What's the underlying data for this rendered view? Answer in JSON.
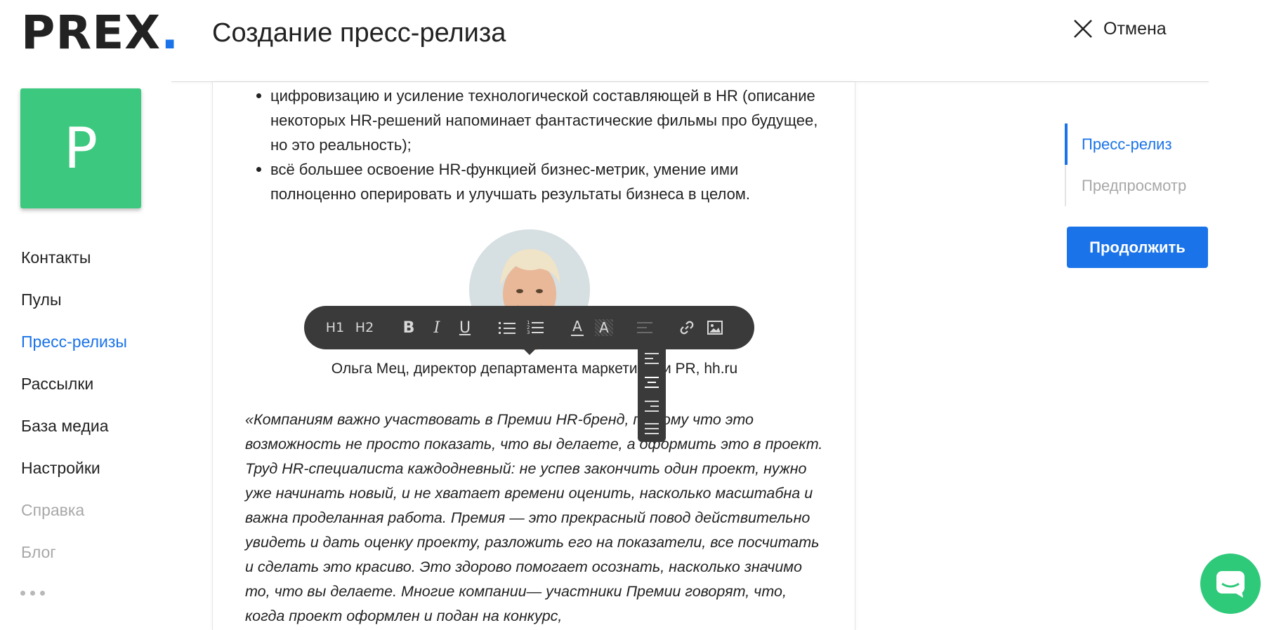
{
  "brand": {
    "name": "PREX",
    "dot": ".",
    "accent": "#1a73e8"
  },
  "avatar": {
    "letter": "P",
    "color": "#3cc97f"
  },
  "sidebar": {
    "items": [
      {
        "label": "Контакты"
      },
      {
        "label": "Пулы"
      },
      {
        "label": "Пресс-релизы"
      },
      {
        "label": "Рассылки"
      },
      {
        "label": "База медиа"
      },
      {
        "label": "Настройки"
      },
      {
        "label": "Справка"
      },
      {
        "label": "Блог"
      }
    ]
  },
  "header": {
    "title": "Создание пресс-релиза",
    "cancel_label": "Отмена"
  },
  "editor": {
    "bullets": [
      "цифровизацию и усиление технологической составляющей в HR (описание некоторых HR-решений напоминает фантастические фильмы про будущее, но это реальность);",
      "всё большее освоение HR-функцией бизнес-метрик, умение ими полноценно оперировать и улучшать результаты бизнеса в целом."
    ],
    "caption": "Ольга Мец, директор департамента маркетинга и PR, hh.ru",
    "quote": "«Компаниям важно участвовать в Премии HR-бренд, потому что это возможность не просто показать, что вы делаете, а оформить это в проект. Труд HR-специалиста каждодневный: не успев закончить один проект, нужно уже начинать новый, и не хватает времени оценить, насколько масштабна и важна проделанная работа. Премия — это прекрасный повод действительно увидеть и дать оценку проекту, разложить его на показатели, все посчитать и сделать это красиво. Это здорово помогает осознать, насколько значимо то, что вы делаете. Многие компании— участники Премии говорят, что, когда проект оформлен и подан на конкурс,"
  },
  "toolbar": {
    "h1": "H1",
    "h2": "H2",
    "bold": "B",
    "italic": "I",
    "underline": "U",
    "text_color": "A",
    "highlight": "A"
  },
  "steps": [
    {
      "label": "Пресс-релиз"
    },
    {
      "label": "Предпросмотр"
    }
  ],
  "continue_label": "Продолжить"
}
